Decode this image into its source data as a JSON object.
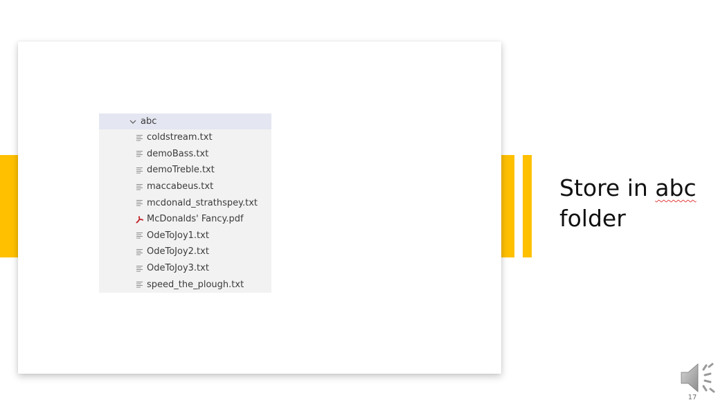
{
  "colors": {
    "accent": "#ffc000",
    "pdf_icon": "#c1272d",
    "text_icon": "#8a8a8a",
    "folder_highlight": "#e4e6f1"
  },
  "explorer": {
    "folder": {
      "name": "abc",
      "icon": "chevron-down-icon"
    },
    "files": [
      {
        "name": "coldstream.txt",
        "icon": "text-file-icon"
      },
      {
        "name": "demoBass.txt",
        "icon": "text-file-icon"
      },
      {
        "name": "demoTreble.txt",
        "icon": "text-file-icon"
      },
      {
        "name": "maccabeus.txt",
        "icon": "text-file-icon"
      },
      {
        "name": "mcdonald_strathspey.txt",
        "icon": "text-file-icon"
      },
      {
        "name": "McDonalds' Fancy.pdf",
        "icon": "pdf-icon"
      },
      {
        "name": "OdeToJoy1.txt",
        "icon": "text-file-icon"
      },
      {
        "name": "OdeToJoy2.txt",
        "icon": "text-file-icon"
      },
      {
        "name": "OdeToJoy3.txt",
        "icon": "text-file-icon"
      },
      {
        "name": "speed_the_plough.txt",
        "icon": "text-file-icon"
      }
    ]
  },
  "slide": {
    "title_line1_prefix": "Store in ",
    "title_line1_word": "abc",
    "title_line2": "folder",
    "number": "17",
    "audio_icon": "speaker-icon"
  }
}
